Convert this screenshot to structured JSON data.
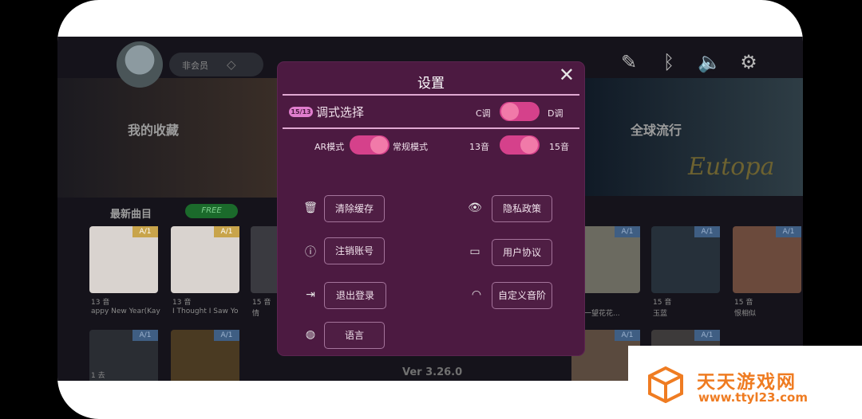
{
  "header": {
    "member_label": "非会员"
  },
  "top_icons": [
    "mic-off-icon",
    "bluetooth-icon",
    "volume-icon",
    "gear-icon"
  ],
  "sections": {
    "favorites": "我的收藏",
    "global": "全球流行",
    "newest": "最新曲目",
    "free": "FREE"
  },
  "covers_row1": [
    {
      "tag": "A/1",
      "caption_top": "13 音",
      "caption_bottom": "appy New Year(Kay"
    },
    {
      "tag": "A/1",
      "caption_top": "13 音",
      "caption_bottom": "I Thought I Saw Yo"
    },
    {
      "tag": "",
      "caption_top": "15 音",
      "caption_bottom": "情"
    },
    {
      "tag": "A/1",
      "caption_top": "15 音",
      "caption_bottom": "一望花花..."
    },
    {
      "tag": "A/1",
      "caption_top": "15 音",
      "caption_bottom": "玉蓝"
    },
    {
      "tag": "A/1",
      "caption_top": "15 音",
      "caption_bottom": "恨相似"
    }
  ],
  "covers_row2": [
    {
      "tag": "A/1",
      "caption_top": "1 去"
    },
    {
      "tag": "A/1"
    },
    {
      "tag": "A/1"
    },
    {
      "tag": "A/1"
    }
  ],
  "banner_text": "Eutopa",
  "version": "Ver 3.26.0",
  "modal": {
    "title": "设置",
    "badge": "15/13",
    "tone_title": "调式选择",
    "c_tone": "C调",
    "d_tone": "D调",
    "ar_mode": "AR模式",
    "normal_mode": "常规模式",
    "tones13": "13音",
    "tones15": "15音",
    "actions": {
      "clear_cache": "清除缓存",
      "privacy": "隐私政策",
      "delete_account": "注销账号",
      "user_agreement": "用户协议",
      "logout": "退出登录",
      "custom_scale": "自定义音阶",
      "language": "语言"
    }
  },
  "watermark": {
    "cn": "天天游戏网",
    "url": "www.ttyl23.com"
  },
  "colors": {
    "modal_bg": "#4c1a41",
    "toggle": "#d5418b",
    "accent_orange": "#ef7c22"
  }
}
